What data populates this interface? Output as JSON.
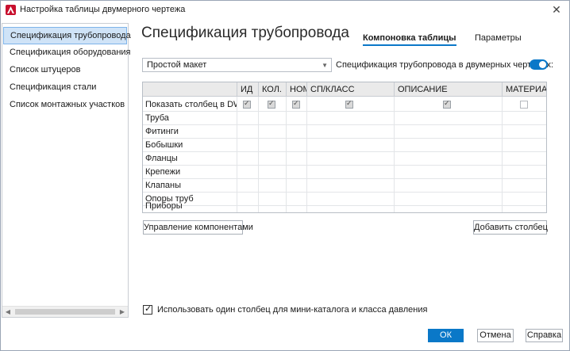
{
  "window": {
    "title": "Настройка таблицы двумерного чертежа",
    "close_glyph": "✕"
  },
  "sidebar": {
    "items": [
      {
        "label": "Спецификация трубопровода",
        "active": true
      },
      {
        "label": "Спецификация оборудования",
        "active": false
      },
      {
        "label": "Список штуцеров",
        "active": false
      },
      {
        "label": "Спецификация стали",
        "active": false
      },
      {
        "label": "Список монтажных участков",
        "active": false
      }
    ]
  },
  "main": {
    "title": "Спецификация трубопровода",
    "tabs": [
      {
        "label": "Компоновка таблицы",
        "active": true
      },
      {
        "label": "Параметры",
        "active": false
      }
    ],
    "layout_select": {
      "value": "Простой макет"
    },
    "toggle": {
      "label": "Спецификация трубопровода  в двумерных чертежах:",
      "on": true
    }
  },
  "table": {
    "columns": [
      "ИД",
      "КОЛ.",
      "НОМ",
      "СП/КЛАСС",
      "ОПИСАНИЕ",
      "МАТЕРИАЛ"
    ],
    "show_row_label": "Показать столбец в DWG",
    "show_row_checked": [
      true,
      true,
      true,
      true,
      true,
      false
    ],
    "rows": [
      "Труба",
      "Фитинги",
      "Бобышки",
      "Фланцы",
      "Крепежи",
      "Клапаны",
      "Опоры труб",
      "Приборы"
    ]
  },
  "buttons": {
    "manage": "Управление компонентами",
    "add_column": "Добавить столбец",
    "ok": "ОК",
    "cancel": "Отмена",
    "help": "Справка"
  },
  "bottom_option": {
    "label": "Использовать один столбец для мини-каталога и класса давления",
    "checked": true
  },
  "colors": {
    "accent": "#0a78c8",
    "sidebar_selected": "#cfe3f7",
    "app_icon": "#c8102e"
  }
}
